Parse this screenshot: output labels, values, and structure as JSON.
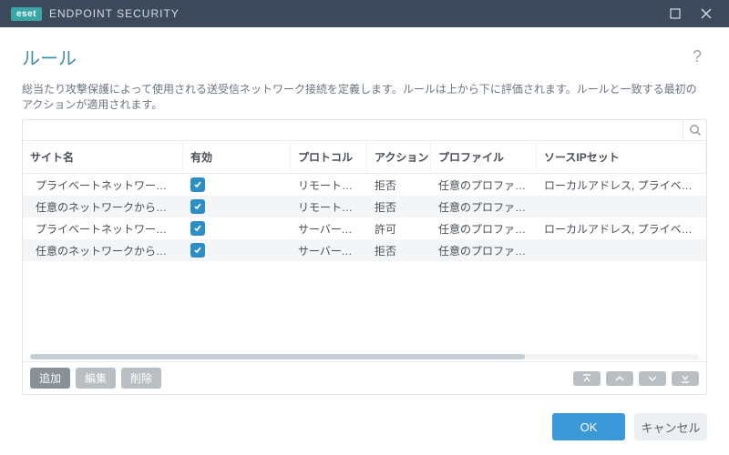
{
  "titlebar": {
    "brand": "eset",
    "app": "ENDPOINT SECURITY"
  },
  "header": {
    "title": "ルール",
    "help": "?"
  },
  "desc": "総当たり攻撃保護によって使用される送受信ネットワーク接続を定義します。ルールは上から下に評価されます。ルールと一致する最初のアクションが適用されます。",
  "search": {
    "placeholder": ""
  },
  "columns": [
    "サイト名",
    "有効",
    "プロトコル",
    "アクション",
    "プロファイル",
    "ソースIPセット"
  ],
  "rows": [
    {
      "site": "プライベートネットワークからのR…",
      "enabled": true,
      "protocol": "リモートデスク…",
      "action": "拒否",
      "profile": "任意のプロファイル",
      "source": "ローカルアドレス, プライベートアドレス"
    },
    {
      "site": "任意のネットワークからのRDP総…",
      "enabled": true,
      "protocol": "リモートデスク…",
      "action": "拒否",
      "profile": "任意のプロファイル",
      "source": ""
    },
    {
      "site": "プライベートネットワークからのS…",
      "enabled": true,
      "protocol": "サーバーメッセ…",
      "action": "許可",
      "profile": "任意のプロファイル",
      "source": "ローカルアドレス, プライベートアドレス"
    },
    {
      "site": "任意のネットワークからのSMB総…",
      "enabled": true,
      "protocol": "サーバーメッセ…",
      "action": "拒否",
      "profile": "任意のプロファイル",
      "source": ""
    }
  ],
  "tableFooter": {
    "add": "追加",
    "edit": "編集",
    "delete": "削除"
  },
  "dialogFooter": {
    "ok": "OK",
    "cancel": "キャンセル"
  },
  "colors": {
    "titlebar": "#3d4a5c",
    "accent": "#39a6aa",
    "link": "#3b99d8"
  }
}
